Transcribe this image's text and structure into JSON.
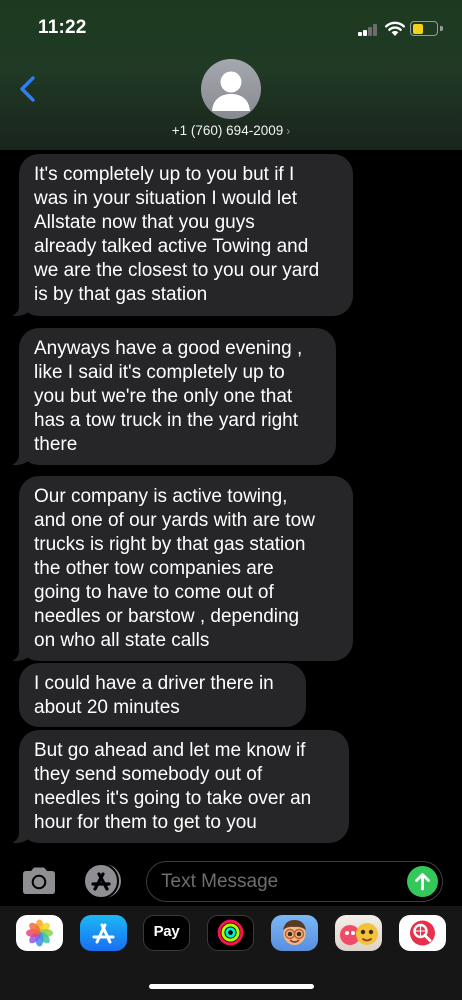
{
  "status_bar": {
    "time": "11:22"
  },
  "contact": {
    "name": "+1 (760) 694-2009",
    "chevron": "›"
  },
  "messages": [
    {
      "text": "It's completely up to you but if I\nwas in your situation I would let\nAllstate now that you guys\nalready talked active Towing and\nwe are the closest to you our yard\nis by that gas station"
    },
    {
      "text": "Anyways have a good evening ,\nlike I said it's completely up to\nyou but we're the only one that\nhas a tow truck in the yard right\nthere"
    },
    {
      "text": "Our company is active towing,\nand  one of our yards with are tow\ntrucks is right by that gas station\nthe other tow companies are\ngoing to have to come out of\nneedles or barstow , depending\non who all state calls"
    },
    {
      "text": "I could have a driver there in\nabout 20 minutes"
    },
    {
      "text": "But go ahead and let me know if\nthey send somebody out of\nneedles it's going to take over an\nhour for them to get to you"
    }
  ],
  "compose": {
    "placeholder": "Text Message",
    "value": ""
  },
  "app_drawer": {
    "apps": [
      {
        "name": "photos-app-icon"
      },
      {
        "name": "app-store-app-icon"
      },
      {
        "name": "apple-pay-app-icon",
        "label": "Pay",
        "glyph": ""
      },
      {
        "name": "activity-app-icon"
      },
      {
        "name": "memoji-app-icon"
      },
      {
        "name": "animoji-app-icon"
      },
      {
        "name": "web-search-app-icon"
      }
    ]
  },
  "colors": {
    "header_gradient_top": "#1d3a1f",
    "bubble_background": "#262628",
    "back_chevron": "#2f7ef5",
    "send_button": "#34c759",
    "battery_fill": "#f2d21b"
  }
}
